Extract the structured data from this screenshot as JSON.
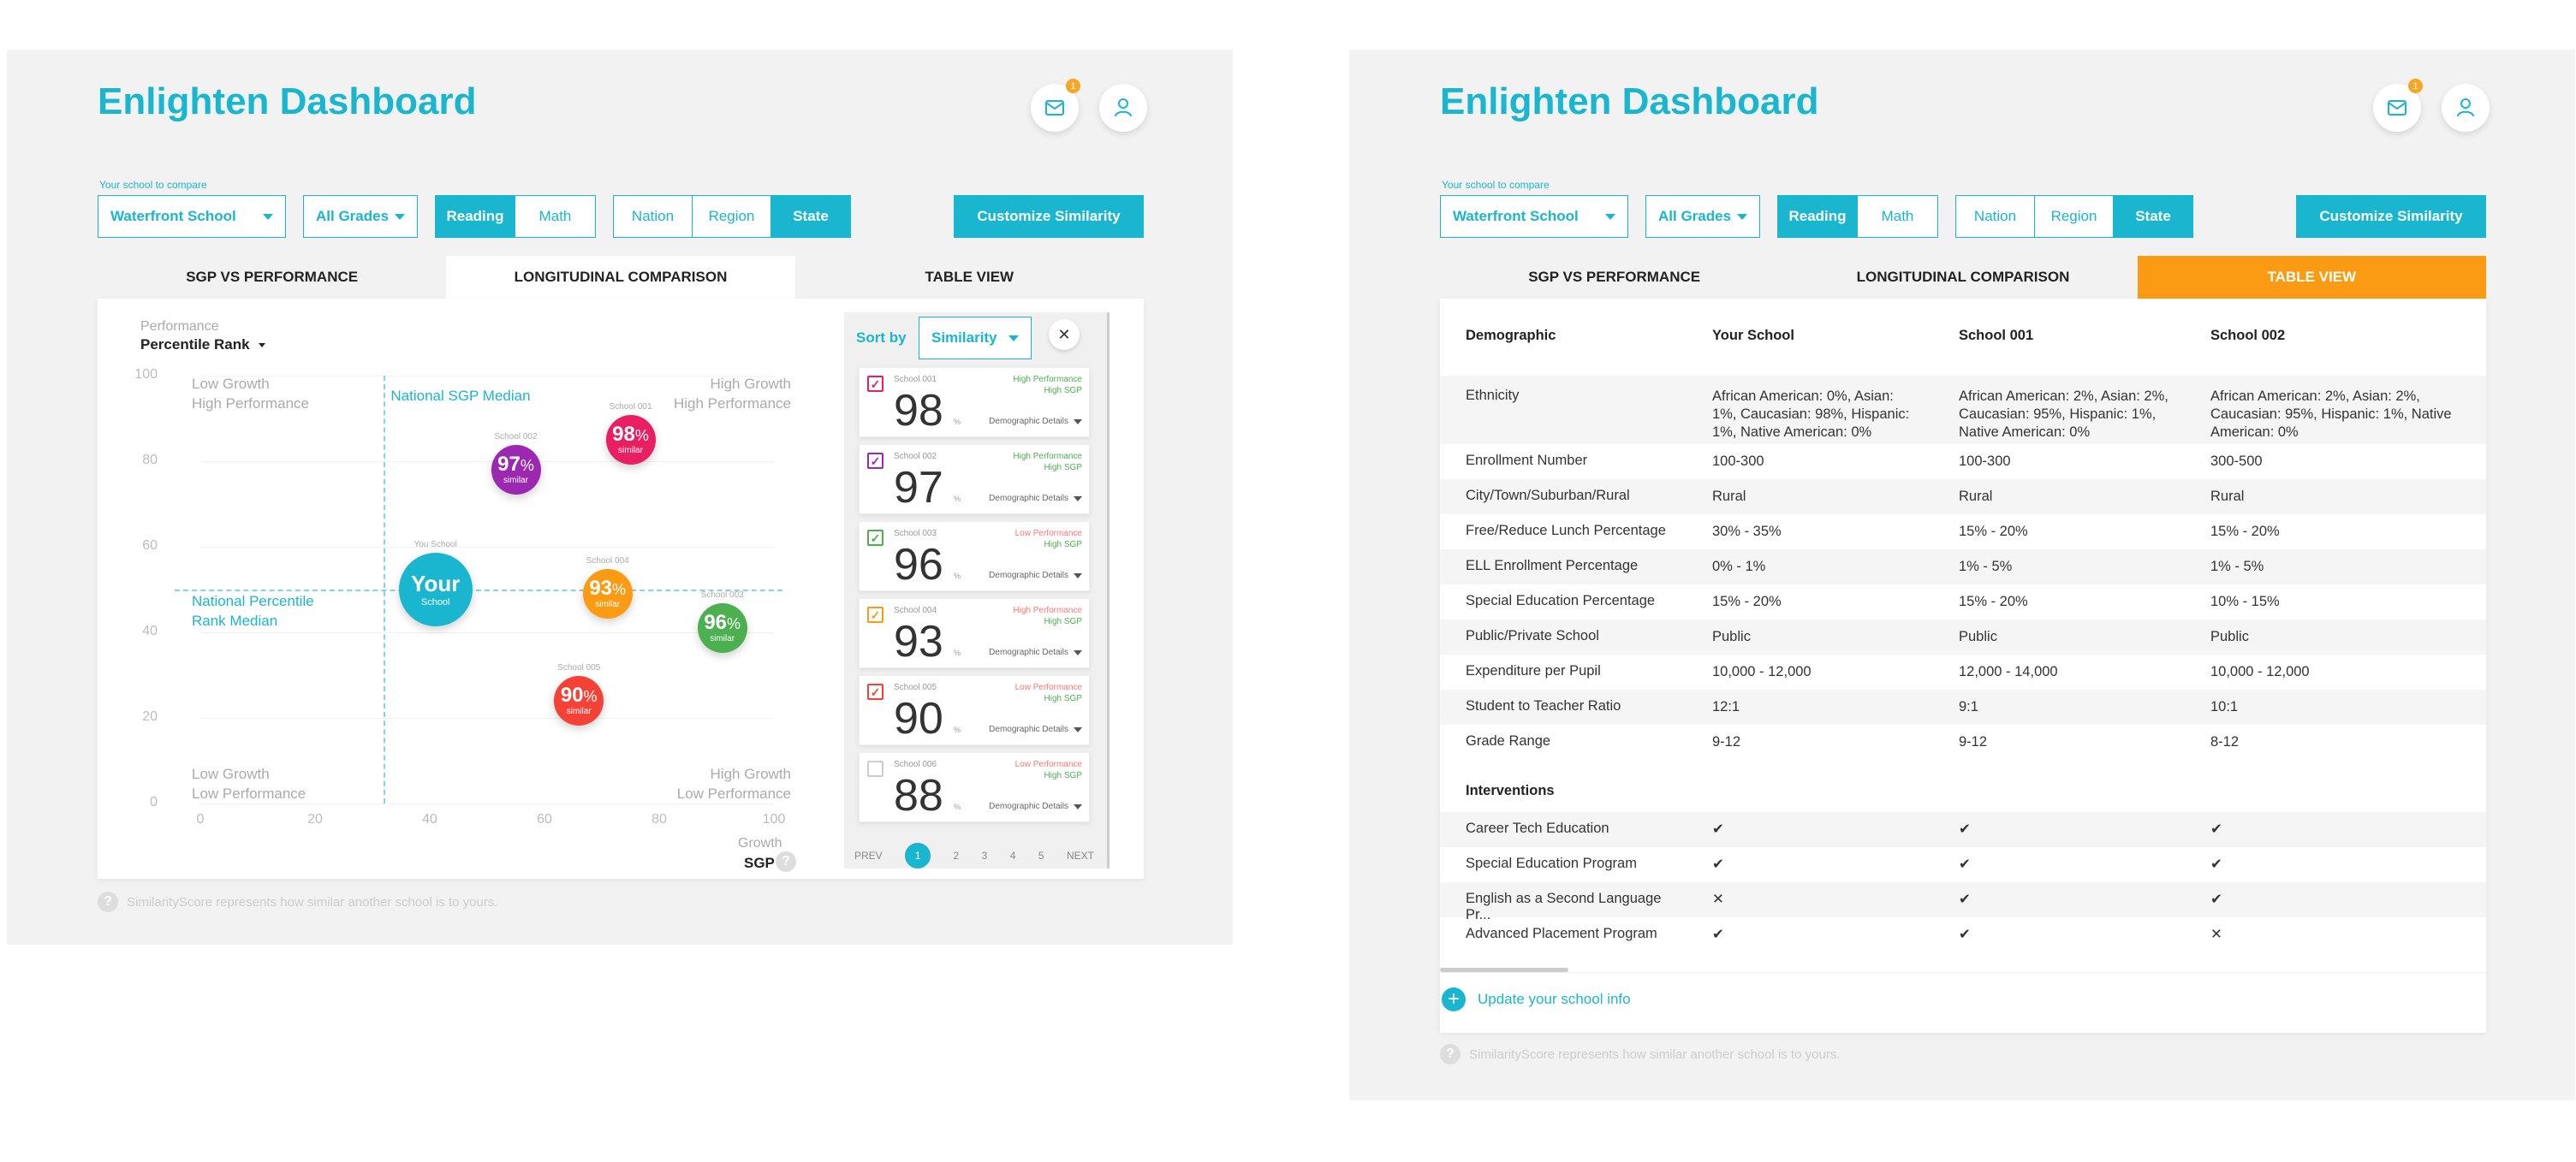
{
  "app_title": "Enlighten Dashboard",
  "notification_count": "1",
  "filters": {
    "school_label": "Your school to compare",
    "school_value": "Waterfront School",
    "grades_value": "All Grades",
    "subjects": [
      "Reading",
      "Math"
    ],
    "selected_subject": "Reading",
    "scopes": [
      "Nation",
      "Region",
      "State"
    ],
    "selected_scope": "State",
    "customize_label": "Customize Similarity"
  },
  "tabs": [
    "SGP VS PERFORMANCE",
    "LONGITUDINAL COMPARISON",
    "TABLE VIEW"
  ],
  "footnote": "SimilarityScore represents how similar another school is to yours.",
  "scatter": {
    "ylabel_top": "Performance",
    "ylabel_select": "Percentile Rank",
    "xlabel_top": "Growth",
    "xlabel": "SGP",
    "quadrants": {
      "tl": "Low Growth\nHigh Performance",
      "tr": "High Growth\nHigh Performance",
      "bl": "Low Growth\nLow Performance",
      "br": "High Growth\nLow Performance"
    },
    "median_v_label": "National SGP Median",
    "median_h_label": "National Percentile\nRank Median",
    "your_school_small": "You School",
    "your_school_big": "Your",
    "your_school_sub": "School",
    "similar_word": "similar"
  },
  "chart_data": {
    "type": "scatter",
    "xlabel": "SGP",
    "ylabel": "Percentile Rank",
    "xlim": [
      0,
      100
    ],
    "ylim": [
      0,
      100
    ],
    "xticks": [
      0,
      20,
      40,
      60,
      80,
      100
    ],
    "yticks": [
      0,
      20,
      40,
      60,
      80,
      100
    ],
    "median_x": 32,
    "median_y": 50,
    "your_school": {
      "x": 41,
      "y": 50
    },
    "points": [
      {
        "label": "School 001",
        "x": 75,
        "y": 85,
        "similarity": 98,
        "color": "#e91e63"
      },
      {
        "label": "School 002",
        "x": 55,
        "y": 78,
        "similarity": 97,
        "color": "#9c27b0"
      },
      {
        "label": "School 004",
        "x": 71,
        "y": 49,
        "similarity": 93,
        "color": "#fb9b13"
      },
      {
        "label": "School 003",
        "x": 91,
        "y": 41,
        "similarity": 96,
        "color": "#4caf50"
      },
      {
        "label": "School 005",
        "x": 66,
        "y": 24,
        "similarity": 90,
        "color": "#f44336"
      }
    ]
  },
  "sort": {
    "label": "Sort by",
    "value": "Similarity",
    "close": "✕"
  },
  "school_list": [
    {
      "name": "School 001",
      "score": "98",
      "perf": "High Performance",
      "sgp": "High SGP",
      "perf_color": "#4caf50",
      "sgp_color": "#4caf50",
      "checked": true,
      "check_color": "#e91e63"
    },
    {
      "name": "School 002",
      "score": "97",
      "perf": "High Performance",
      "sgp": "High SGP",
      "perf_color": "#4caf50",
      "sgp_color": "#4caf50",
      "checked": true,
      "check_color": "#9c27b0"
    },
    {
      "name": "School 003",
      "score": "96",
      "perf": "Low Performance",
      "sgp": "High SGP",
      "perf_color": "#f77",
      "sgp_color": "#4caf50",
      "checked": true,
      "check_color": "#4caf50"
    },
    {
      "name": "School 004",
      "score": "93",
      "perf": "High Performance",
      "sgp": "High SGP",
      "perf_color": "#f77",
      "sgp_color": "#4caf50",
      "checked": true,
      "check_color": "#fb9b13"
    },
    {
      "name": "School 005",
      "score": "90",
      "perf": "Low Performance",
      "sgp": "High SGP",
      "perf_color": "#f77",
      "sgp_color": "#4caf50",
      "checked": true,
      "check_color": "#f44336"
    },
    {
      "name": "School 006",
      "score": "88",
      "perf": "Low Performance",
      "sgp": "High SGP",
      "perf_color": "#f77",
      "sgp_color": "#4caf50",
      "checked": false,
      "check_color": "#ccc"
    }
  ],
  "percent_sign": "%",
  "details_label": "Demographic Details",
  "pagination": {
    "prev": "PREV",
    "pages": [
      "1",
      "2",
      "3",
      "4",
      "5"
    ],
    "current": "1",
    "next": "NEXT"
  },
  "table": {
    "headers": [
      "Demographic",
      "Your School",
      "School 001",
      "School 002"
    ],
    "rows": [
      [
        "Ethnicity",
        "African American: 0%, Asian: 1%, Caucasian: 98%, Hispanic: 1%, Native American: 0%",
        "African American: 2%, Asian: 2%, Caucasian: 95%, Hispanic: 1%, Native American: 0%",
        "African American: 2%, Asian: 2%, Caucasian: 95%, Hispanic: 1%, Native American: 0%"
      ],
      [
        "Enrollment Number",
        "100-300",
        "100-300",
        "300-500"
      ],
      [
        "City/Town/Suburban/Rural",
        "Rural",
        "Rural",
        "Rural"
      ],
      [
        "Free/Reduce Lunch Percentage",
        "30% - 35%",
        "15% - 20%",
        "15% - 20%"
      ],
      [
        "ELL Enrollment Percentage",
        "0% - 1%",
        "1% - 5%",
        "1% - 5%"
      ],
      [
        "Special Education Percentage",
        "15% - 20%",
        "15% - 20%",
        "10% - 15%"
      ],
      [
        "Public/Private School",
        "Public",
        "Public",
        "Public"
      ],
      [
        "Expenditure per Pupil",
        "10,000 - 12,000",
        "12,000 - 14,000",
        "10,000 - 12,000"
      ],
      [
        "Student to Teacher Ratio",
        "12:1",
        "9:1",
        "10:1"
      ],
      [
        "Grade Range",
        "9-12",
        "9-12",
        "8-12"
      ]
    ],
    "interventions_title": "Interventions",
    "interventions": [
      [
        "Career Tech Education",
        "✔",
        "✔",
        "✔"
      ],
      [
        "Special Education Program",
        "✔",
        "✔",
        "✔"
      ],
      [
        "English as a Second Language Pr...",
        "✕",
        "✔",
        "✔"
      ],
      [
        "Advanced Placement Program",
        "✔",
        "✔",
        "✕"
      ]
    ],
    "update_label": "Update your school info"
  }
}
